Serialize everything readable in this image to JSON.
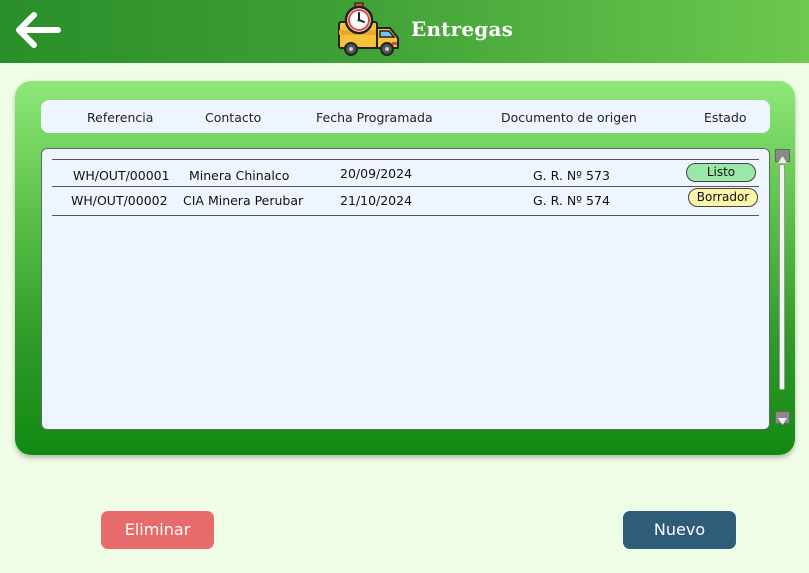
{
  "header": {
    "title": "Entregas",
    "back_icon": "arrow-left-icon",
    "logo_icon": "delivery-truck-clock-icon"
  },
  "table": {
    "columns": [
      "Referencia",
      "Contacto",
      "Fecha Programada",
      "Documento de origen",
      "Estado"
    ],
    "rows": [
      {
        "referencia": "WH/OUT/00001",
        "contacto": "Minera Chinalco",
        "fecha": "20/09/2024",
        "documento": "G. R. Nº 573",
        "estado": "Listo"
      },
      {
        "referencia": "WH/OUT/00002",
        "contacto": "CIA Minera Perubar",
        "fecha": "21/10/2024",
        "documento": "G. R. Nº 574",
        "estado": "Borrador"
      }
    ]
  },
  "status_colors": {
    "Listo": "#9ae8a8",
    "Borrador": "#fbf6a6"
  },
  "actions": {
    "delete_label": "Eliminar",
    "new_label": "Nuevo"
  },
  "colors": {
    "header_gradient_start": "#2a8f2a",
    "header_gradient_end": "#6cc84e",
    "page_background": "#effde6",
    "delete_button": "#e86b6b",
    "new_button": "#2f5c78"
  }
}
